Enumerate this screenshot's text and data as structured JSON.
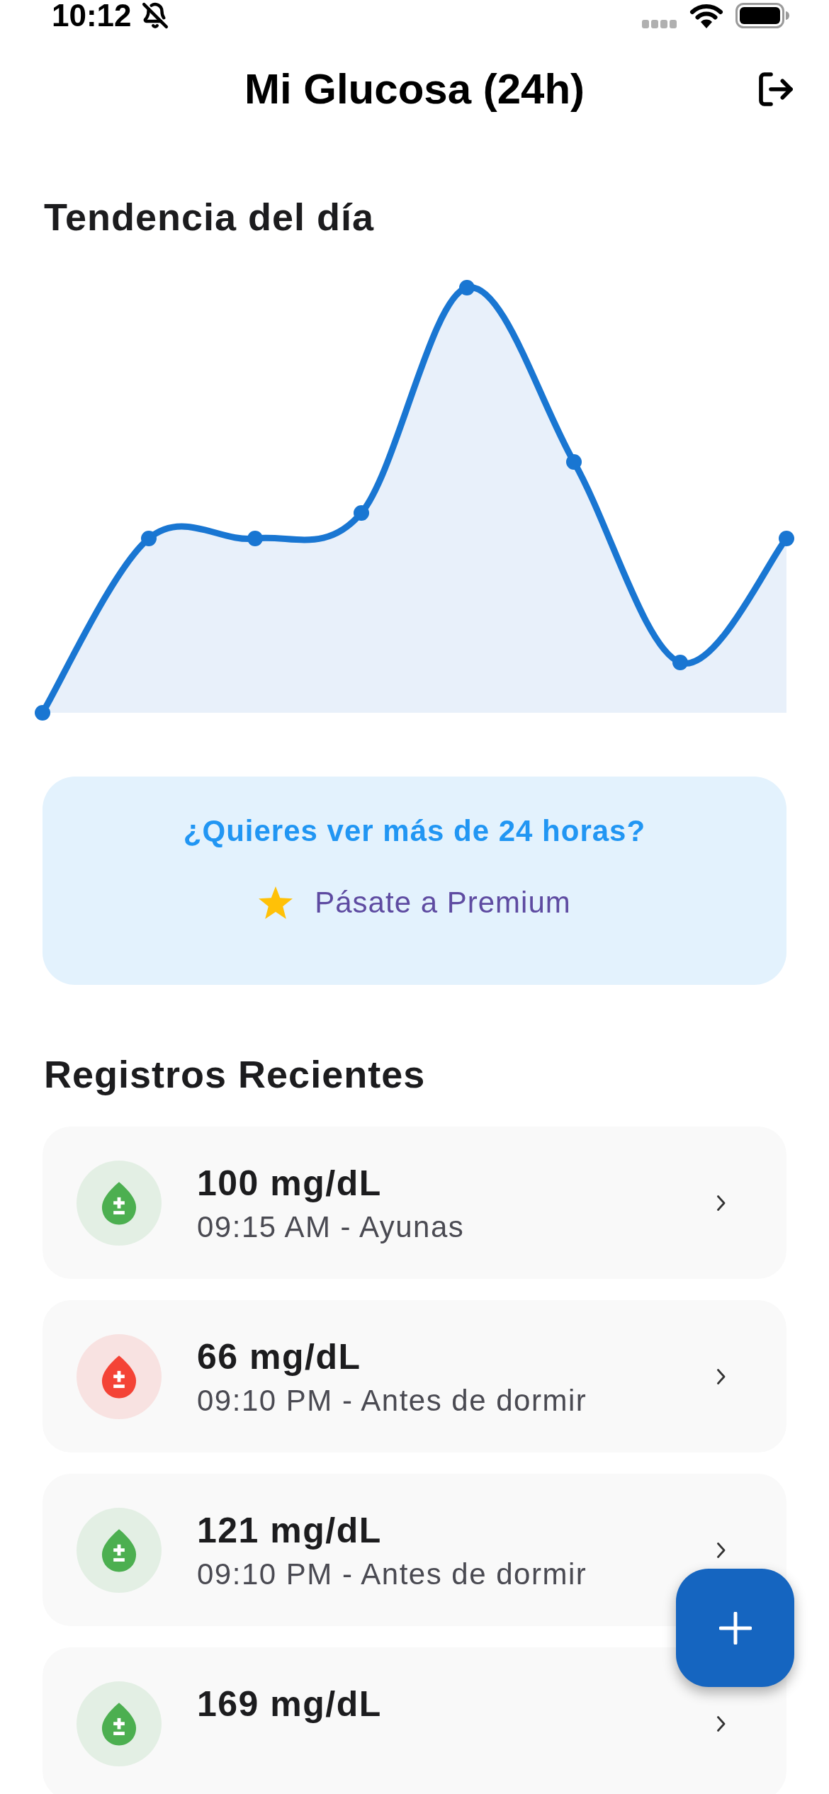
{
  "status_bar": {
    "time": "10:12"
  },
  "header": {
    "title": "Mi Glucosa (24h)"
  },
  "trend": {
    "title": "Tendencia del día"
  },
  "premium_card": {
    "question": "¿Quieres ver más de 24 horas?",
    "link": "Pásate a Premium"
  },
  "recent": {
    "title": "Registros Recientes",
    "records": [
      {
        "value": "100 mg/dL",
        "detail": "09:15 AM - Ayunas",
        "color": "#4caf50"
      },
      {
        "value": "66 mg/dL",
        "detail": "09:10 PM - Antes de dormir",
        "color": "#f44336"
      },
      {
        "value": "121 mg/dL",
        "detail": "09:10 PM - Antes de dormir",
        "color": "#4caf50"
      },
      {
        "value": "169 mg/dL",
        "color": "#4caf50"
      }
    ]
  }
}
